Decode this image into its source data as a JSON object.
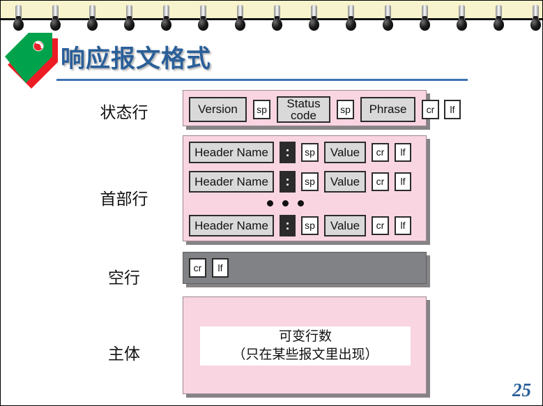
{
  "slide": {
    "title": "响应报文格式",
    "page_number": "25",
    "accent_color": "#2A5F99",
    "rule_color": "#3E73B0",
    "logo": {
      "icon": "green-red-tag-icon",
      "green": "#00A24B",
      "red": "#ED1C24"
    },
    "binding": {
      "icon": "spiral-binding-pins",
      "band_color": "#F7F4CD",
      "pin_count": 15
    }
  },
  "diagram": {
    "rows": [
      {
        "label": "状态行",
        "kind": "status-line",
        "bg": "#F9D5E2",
        "fields": [
          {
            "text": "Version",
            "style": "wide"
          },
          {
            "text": "sp",
            "style": "small"
          },
          {
            "text": "Status\ncode",
            "style": "wide"
          },
          {
            "text": "sp",
            "style": "small"
          },
          {
            "text": "Phrase",
            "style": "wide"
          },
          {
            "text": "cr",
            "style": "small"
          },
          {
            "text": "lf",
            "style": "small"
          }
        ]
      },
      {
        "label": "首部行",
        "kind": "header-lines",
        "bg": "#F9D5E2",
        "ellipsis": "•••",
        "lines": [
          [
            {
              "text": "Header Name",
              "style": "wide"
            },
            {
              "text": ":",
              "style": "colon"
            },
            {
              "text": "sp",
              "style": "small"
            },
            {
              "text": "Value",
              "style": "medium"
            },
            {
              "text": "cr",
              "style": "small"
            },
            {
              "text": "lf",
              "style": "small"
            }
          ],
          [
            {
              "text": "Header Name",
              "style": "wide"
            },
            {
              "text": ":",
              "style": "colon"
            },
            {
              "text": "sp",
              "style": "small"
            },
            {
              "text": "Value",
              "style": "medium"
            },
            {
              "text": "cr",
              "style": "small"
            },
            {
              "text": "lf",
              "style": "small"
            }
          ],
          [
            {
              "text": "Header Name",
              "style": "wide"
            },
            {
              "text": ":",
              "style": "colon"
            },
            {
              "text": "sp",
              "style": "small"
            },
            {
              "text": "Value",
              "style": "medium"
            },
            {
              "text": "cr",
              "style": "small"
            },
            {
              "text": "lf",
              "style": "small"
            }
          ]
        ]
      },
      {
        "label": "空行",
        "kind": "blank-line",
        "bg": "#808285",
        "fields": [
          {
            "text": "cr",
            "style": "small"
          },
          {
            "text": "lf",
            "style": "small"
          }
        ]
      },
      {
        "label": "主体",
        "kind": "entity-body",
        "bg": "#F9D5E2",
        "body_line1": "可变行数",
        "body_line2": "（只在某些报文里出现）"
      }
    ]
  }
}
